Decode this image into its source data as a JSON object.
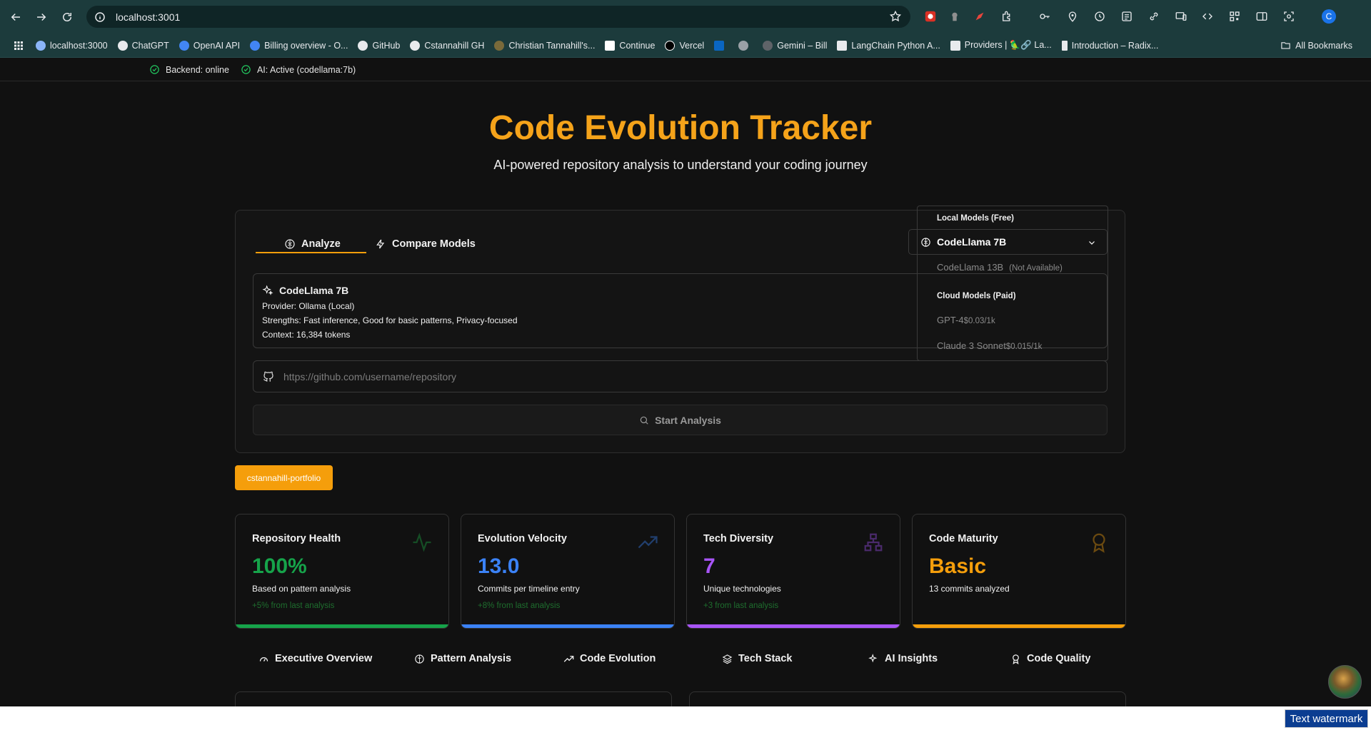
{
  "browser": {
    "url": "localhost:3001",
    "profile_initial": "C",
    "bookmarks": [
      "localhost:3000",
      "ChatGPT",
      "OpenAI API",
      "Billing overview - O...",
      "GitHub",
      "Cstannahill GH",
      "Christian Tannahill's...",
      "Continue",
      "Vercel",
      "",
      "",
      "Gemini – Bill",
      "LangChain Python A...",
      "Providers | 🦜🔗 La...",
      "Introduction – Radix..."
    ],
    "all_bookmarks": "All Bookmarks"
  },
  "status": {
    "backend": "Backend: online",
    "ai": "AI: Active (codellama:7b)"
  },
  "hero": {
    "title": "Code Evolution Tracker",
    "subtitle": "AI-powered repository analysis to understand your coding journey"
  },
  "tabs": {
    "analyze": "Analyze",
    "compare": "Compare Models"
  },
  "model_select": {
    "selected": "CodeLlama 7B",
    "groups": {
      "local": "Local Models (Free)",
      "cloud": "Cloud Models (Paid)"
    },
    "options": {
      "codellama13b": {
        "name": "CodeLlama 13B",
        "note": "(Not Available)"
      },
      "gpt4": {
        "name": "GPT-4",
        "price": "$0.03/1k"
      },
      "claude": {
        "name": "Claude 3 Sonnet",
        "price": "$0.015/1k"
      }
    }
  },
  "model_info": {
    "name": "CodeLlama 7B",
    "provider": "Provider: Ollama (Local)",
    "strengths": "Strengths: Fast inference, Good for basic patterns, Privacy-focused",
    "context": "Context: 16,384 tokens"
  },
  "repo_input": {
    "placeholder": "https://github.com/username/repository",
    "value": ""
  },
  "start_button": "Start Analysis",
  "repo_chip": "cstannahill-portfolio",
  "metrics": [
    {
      "label": "Repository Health",
      "value": "100%",
      "desc": "Based on pattern analysis",
      "change": "+5% from last analysis",
      "color": "#16a34a"
    },
    {
      "label": "Evolution Velocity",
      "value": "13.0",
      "desc": "Commits per timeline entry",
      "change": "+8% from last analysis",
      "color": "#3b82f6"
    },
    {
      "label": "Tech Diversity",
      "value": "7",
      "desc": "Unique technologies",
      "change": "+3 from last analysis",
      "color": "#a855f7"
    },
    {
      "label": "Code Maturity",
      "value": "Basic",
      "desc": "13 commits analyzed",
      "change": "",
      "color": "#f59e0b"
    }
  ],
  "bottom_tabs": [
    "Executive Overview",
    "Pattern Analysis",
    "Code Evolution",
    "Tech Stack",
    "AI Insights",
    "Code Quality"
  ],
  "watermark": "Text watermark"
}
